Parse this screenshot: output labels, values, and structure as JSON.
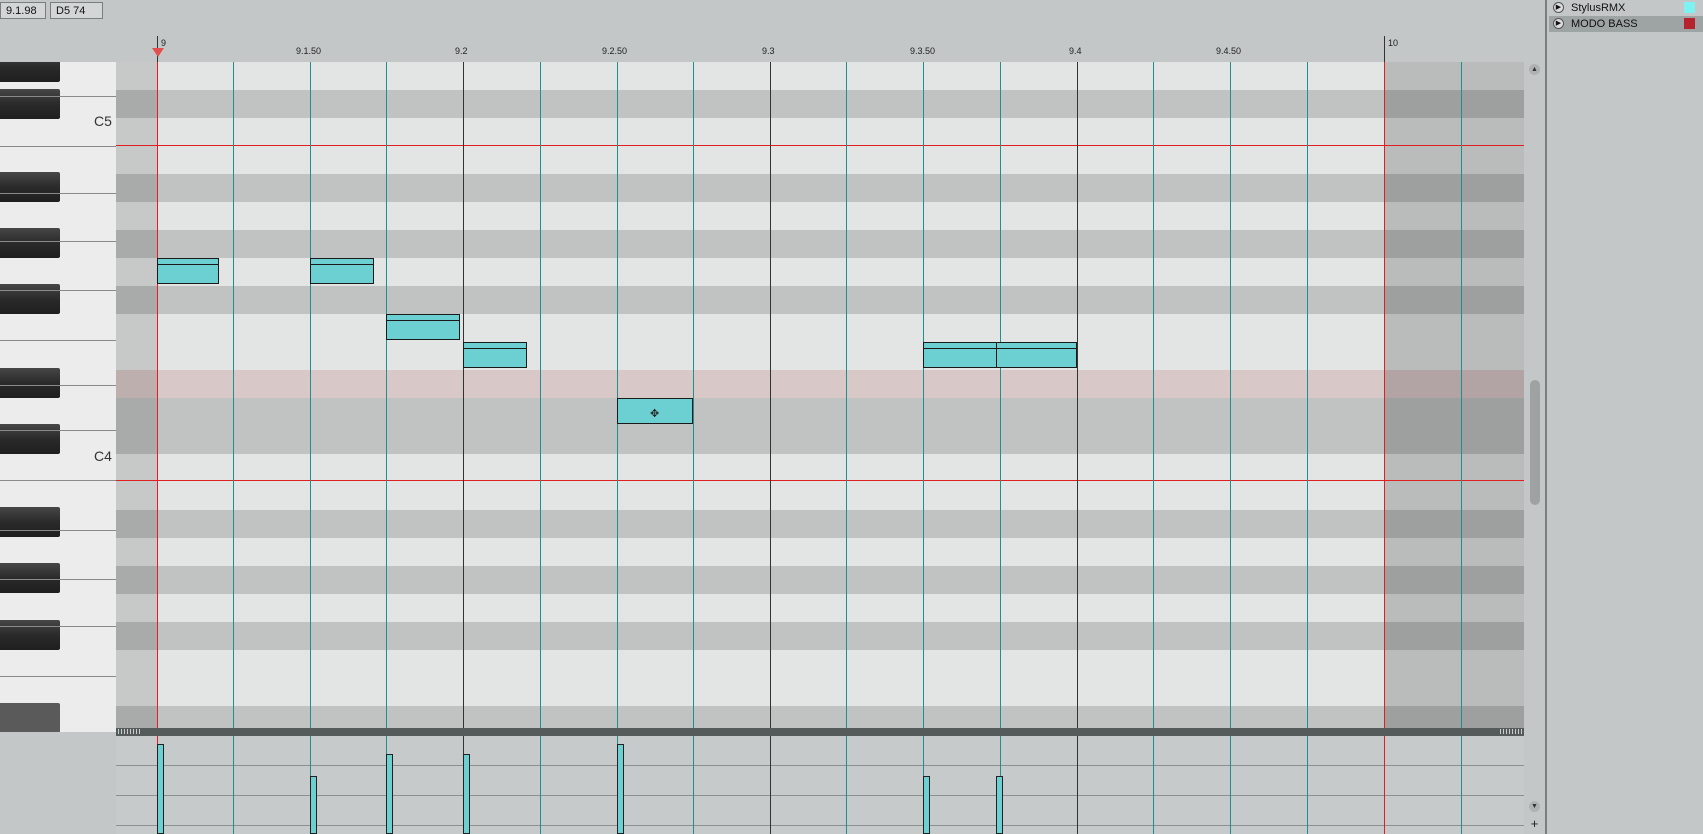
{
  "toolbar": {
    "position": "9.1.98",
    "note_info": "D5  74"
  },
  "ruler": {
    "labels": [
      "9",
      "9.1.50",
      "9.2",
      "9.2.50",
      "9.3",
      "9.3.50",
      "9.4",
      "9.4.50",
      "10"
    ]
  },
  "keyboard": {
    "labels": [
      "C5",
      "C4"
    ]
  },
  "tracks": [
    {
      "name": "StylusRMX",
      "color": "#7ef1f1"
    },
    {
      "name": "MODO BASS",
      "color": "#b5242c"
    }
  ],
  "colors": {
    "note_fill": "#6ccfd1",
    "playhead": "#e02020",
    "beat_line": "#1f8f8f",
    "highlight_row": "#d9c8c8"
  },
  "icons": [
    "play-icon",
    "scroll-up-icon",
    "scroll-down-icon",
    "add-lane-icon",
    "cursor-icon"
  ]
}
